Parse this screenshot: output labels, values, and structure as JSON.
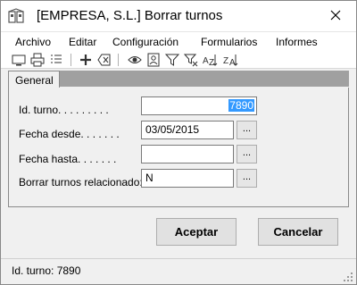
{
  "window": {
    "title": "[EMPRESA, S.L.] Borrar turnos"
  },
  "menu": {
    "items": [
      {
        "label": "Archivo"
      },
      {
        "label": "Editar"
      },
      {
        "label": "Configuración"
      },
      {
        "label": "Formularios"
      },
      {
        "label": "Informes"
      }
    ]
  },
  "toolbar": {
    "icons": [
      "preview-icon",
      "print-icon",
      "list-icon",
      "add-icon",
      "delete-icon",
      "view-icon",
      "record-icon",
      "filter-icon",
      "clear-filter-icon",
      "sort-asc-icon",
      "sort-desc-icon"
    ]
  },
  "tabs": [
    {
      "label": "General",
      "active": true
    }
  ],
  "form": {
    "id_turno": {
      "label": "Id. turno. . . . . . . . .",
      "value": "7890"
    },
    "fecha_desde": {
      "label": "Fecha desde. . . . . . .",
      "value": "03/05/2015",
      "button": "..."
    },
    "fecha_hasta": {
      "label": "Fecha hasta. . . . . . .",
      "value": "",
      "button": "..."
    },
    "borrar_relacionados": {
      "label": "Borrar turnos relacionado:",
      "value": "N",
      "button": "..."
    }
  },
  "buttons": {
    "accept": "Aceptar",
    "cancel": "Cancelar"
  },
  "status": {
    "text": "Id. turno: 7890"
  }
}
